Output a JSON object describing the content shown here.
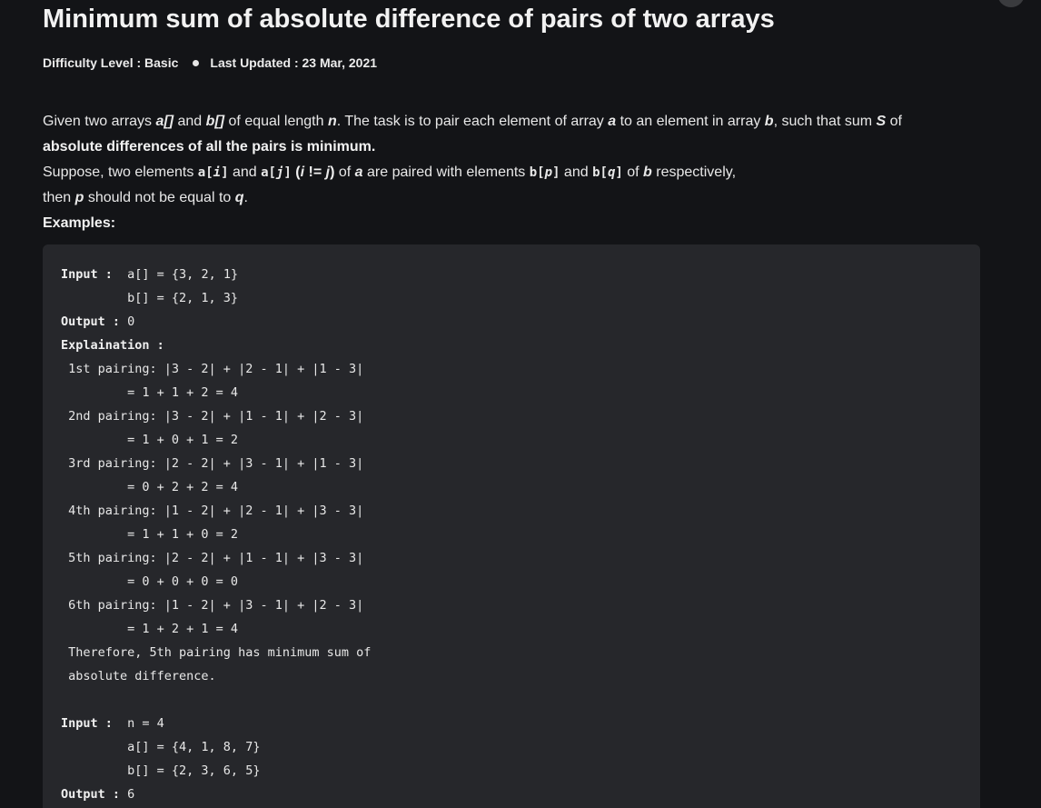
{
  "article": {
    "title": "Minimum sum of absolute difference of pairs of two arrays",
    "difficulty": "Difficulty Level : Basic",
    "last_updated": "Last Updated : 23 Mar, 2021"
  },
  "description": {
    "line1": {
      "t1": "Given two arrays ",
      "a_arr": "a[]",
      "t2": " and ",
      "b_arr": "b[]",
      "t3": " of equal length ",
      "n": "n",
      "t4": ". The task is to pair each element of array ",
      "a": "a",
      "t5": " to an element in array ",
      "b": "b",
      "t6": ", such that sum ",
      "S": "S",
      "t7": " of"
    },
    "line2": "absolute differences of all the pairs is minimum.",
    "line3": {
      "t1": "Suppose, two elements ",
      "ai": "a[",
      "i1": "i",
      "close1": "]",
      "t2": " and ",
      "aj": "a[",
      "j1": "j",
      "close2": "]",
      "open_paren": " (",
      "i2": "i",
      "neq": " != ",
      "j2": "j",
      "close_paren": ")",
      "t3": " of ",
      "a": "a",
      "t4": " are paired with elements ",
      "bp": "b[",
      "p1": "p",
      "close3": "]",
      "t5": " and ",
      "bq": "b[",
      "q1": "q",
      "close4": "]",
      "t6": " of ",
      "b": "b",
      "t7": " respectively,"
    },
    "line4": {
      "t1": "then ",
      "p": "p",
      "t2": " should not be equal to ",
      "q": "q",
      "t3": "."
    },
    "examples_heading": "Examples:"
  },
  "code_example": {
    "lines": [
      {
        "label": "Input :",
        "rest": "  a[] = {3, 2, 1}"
      },
      {
        "label": "",
        "rest": "         b[] = {2, 1, 3}"
      },
      {
        "label": "Output :",
        "rest": " 0"
      },
      {
        "label": "Explaination :",
        "rest": ""
      },
      {
        "label": "",
        "rest": " 1st pairing: |3 - 2| + |2 - 1| + |1 - 3|"
      },
      {
        "label": "",
        "rest": "         = 1 + 1 + 2 = 4"
      },
      {
        "label": "",
        "rest": " 2nd pairing: |3 - 2| + |1 - 1| + |2 - 3|"
      },
      {
        "label": "",
        "rest": "         = 1 + 0 + 1 = 2"
      },
      {
        "label": "",
        "rest": " 3rd pairing: |2 - 2| + |3 - 1| + |1 - 3|"
      },
      {
        "label": "",
        "rest": "         = 0 + 2 + 2 = 4"
      },
      {
        "label": "",
        "rest": " 4th pairing: |1 - 2| + |2 - 1| + |3 - 3|"
      },
      {
        "label": "",
        "rest": "         = 1 + 1 + 0 = 2"
      },
      {
        "label": "",
        "rest": " 5th pairing: |2 - 2| + |1 - 1| + |3 - 3|"
      },
      {
        "label": "",
        "rest": "         = 0 + 0 + 0 = 0"
      },
      {
        "label": "",
        "rest": " 6th pairing: |1 - 2| + |3 - 1| + |2 - 3|"
      },
      {
        "label": "",
        "rest": "         = 1 + 2 + 1 = 4"
      },
      {
        "label": "",
        "rest": " Therefore, 5th pairing has minimum sum of"
      },
      {
        "label": "",
        "rest": " absolute difference."
      },
      {
        "label": "",
        "rest": ""
      },
      {
        "label": "Input :",
        "rest": "  n = 4"
      },
      {
        "label": "",
        "rest": "         a[] = {4, 1, 8, 7}"
      },
      {
        "label": "",
        "rest": "         b[] = {2, 3, 6, 5}"
      },
      {
        "label": "Output :",
        "rest": " 6"
      }
    ]
  }
}
